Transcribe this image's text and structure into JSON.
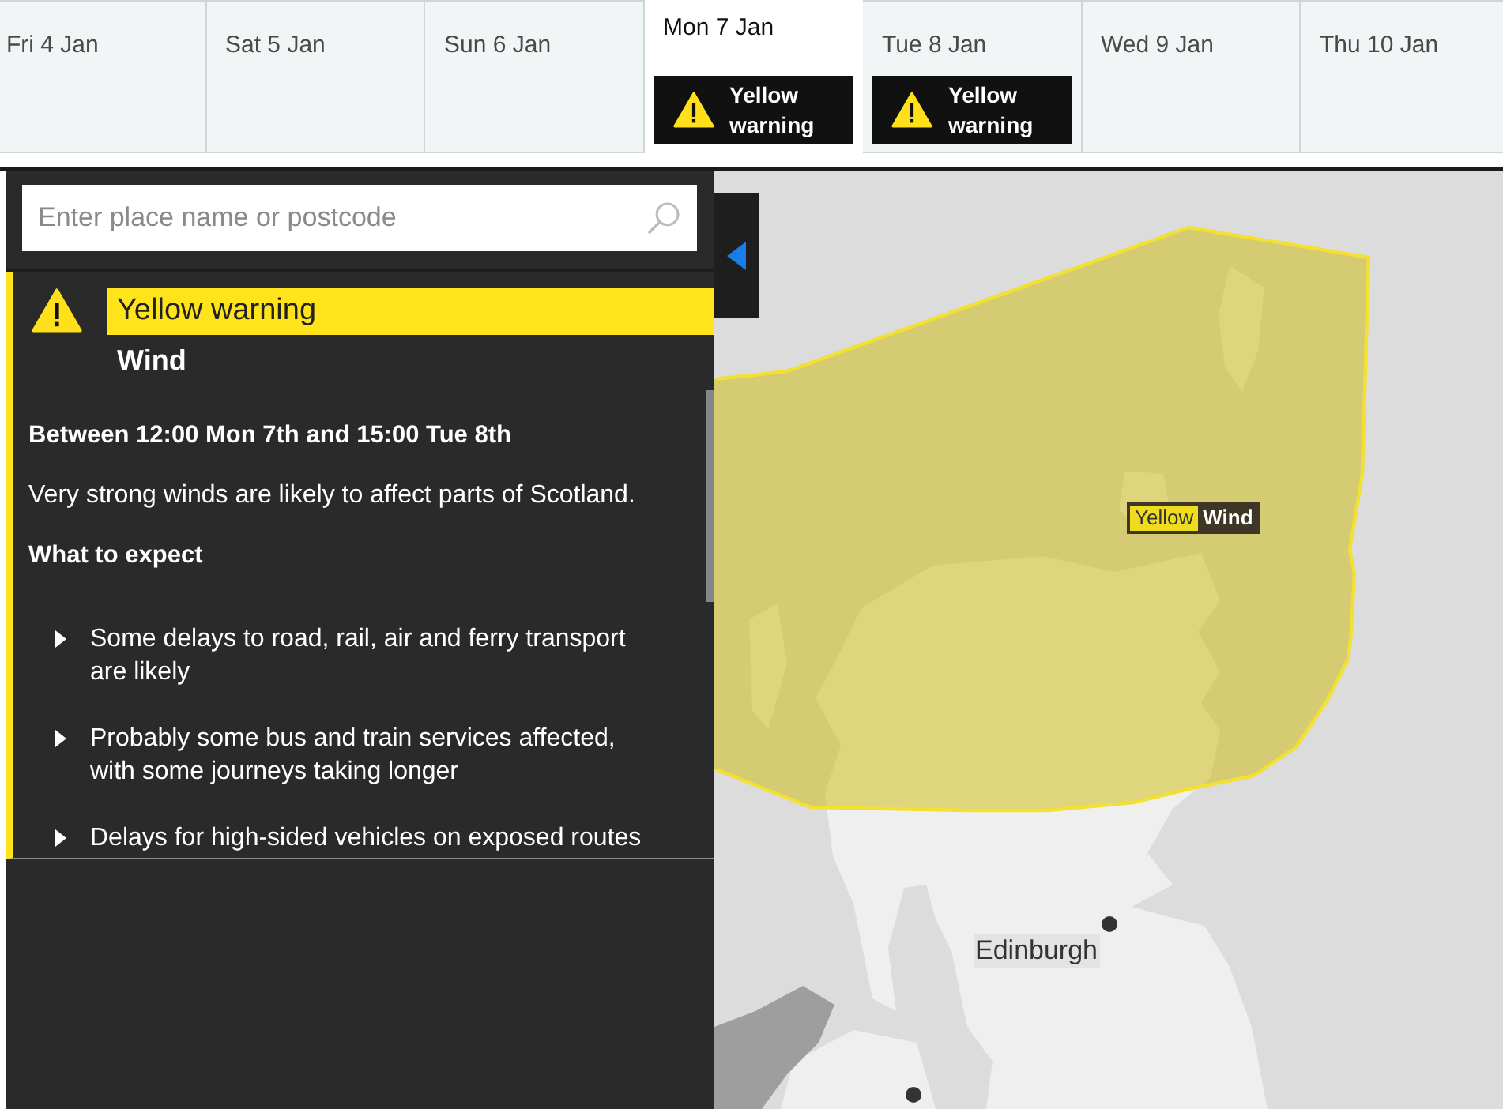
{
  "days": [
    {
      "label": "Fri 4 Jan",
      "selected": false
    },
    {
      "label": "Sat 5 Jan",
      "selected": false
    },
    {
      "label": "Sun 6 Jan",
      "selected": false
    },
    {
      "label": "Mon 7 Jan",
      "selected": true,
      "warning": "Yellow warning"
    },
    {
      "label": "Tue 8 Jan",
      "selected": false,
      "warning": "Yellow warning"
    },
    {
      "label": "Wed 9 Jan",
      "selected": false
    },
    {
      "label": "Thu 10 Jan",
      "selected": false
    }
  ],
  "search": {
    "placeholder": "Enter place name or postcode"
  },
  "warning": {
    "level": "Yellow warning",
    "type": "Wind",
    "period": "Between 12:00 Mon 7th and 15:00 Tue 8th",
    "summary": "Very strong winds are likely to affect parts of Scotland.",
    "expect_heading": "What to expect",
    "expect_items": [
      "Some delays to road, rail, air and ferry transport are likely",
      "Probably some bus and train services affected, with some journeys taking longer",
      "Delays for high-sided vehicles on exposed routes"
    ]
  },
  "map": {
    "warning_label": {
      "level": "Yellow",
      "type": "Wind"
    },
    "places": [
      {
        "name": "Edinburgh"
      }
    ]
  }
}
